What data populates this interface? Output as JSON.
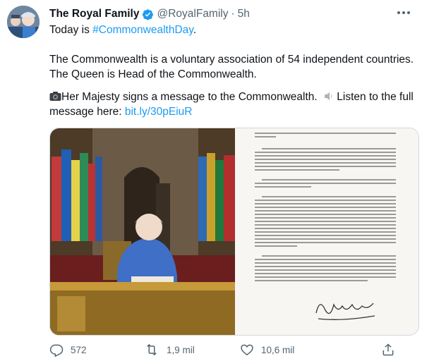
{
  "user": {
    "display_name": "The Royal Family",
    "handle": "@RoyalFamily",
    "separator": "·",
    "time": "5h"
  },
  "tweet": {
    "line1_prefix": "Today is ",
    "hashtag": "#CommonwealthDay",
    "line1_suffix": ".",
    "para2_line1": "The Commonwealth is a voluntary association of 54 independent countries.",
    "para2_line2": "The Queen is Head of the Commonwealth.",
    "para3_line1_a": "Her Majesty signs a message to the Commonwealth.",
    "para3_line1_b": " Listen to the full",
    "para3_line2_prefix": "message here: ",
    "link": "bit.ly/30pEiuR"
  },
  "letter": {
    "signature": "Elizabeth R"
  },
  "actions": {
    "replies": "572",
    "retweets": "1,9 mil",
    "likes": "10,6 mil"
  },
  "colors": {
    "link": "#1d9bf0",
    "verified": "#1d9bf0",
    "muted": "#536471"
  },
  "icons": [
    "verified-badge-icon",
    "more-icon",
    "camera-icon",
    "speaker-icon",
    "reply-icon",
    "retweet-icon",
    "like-icon",
    "share-icon"
  ]
}
